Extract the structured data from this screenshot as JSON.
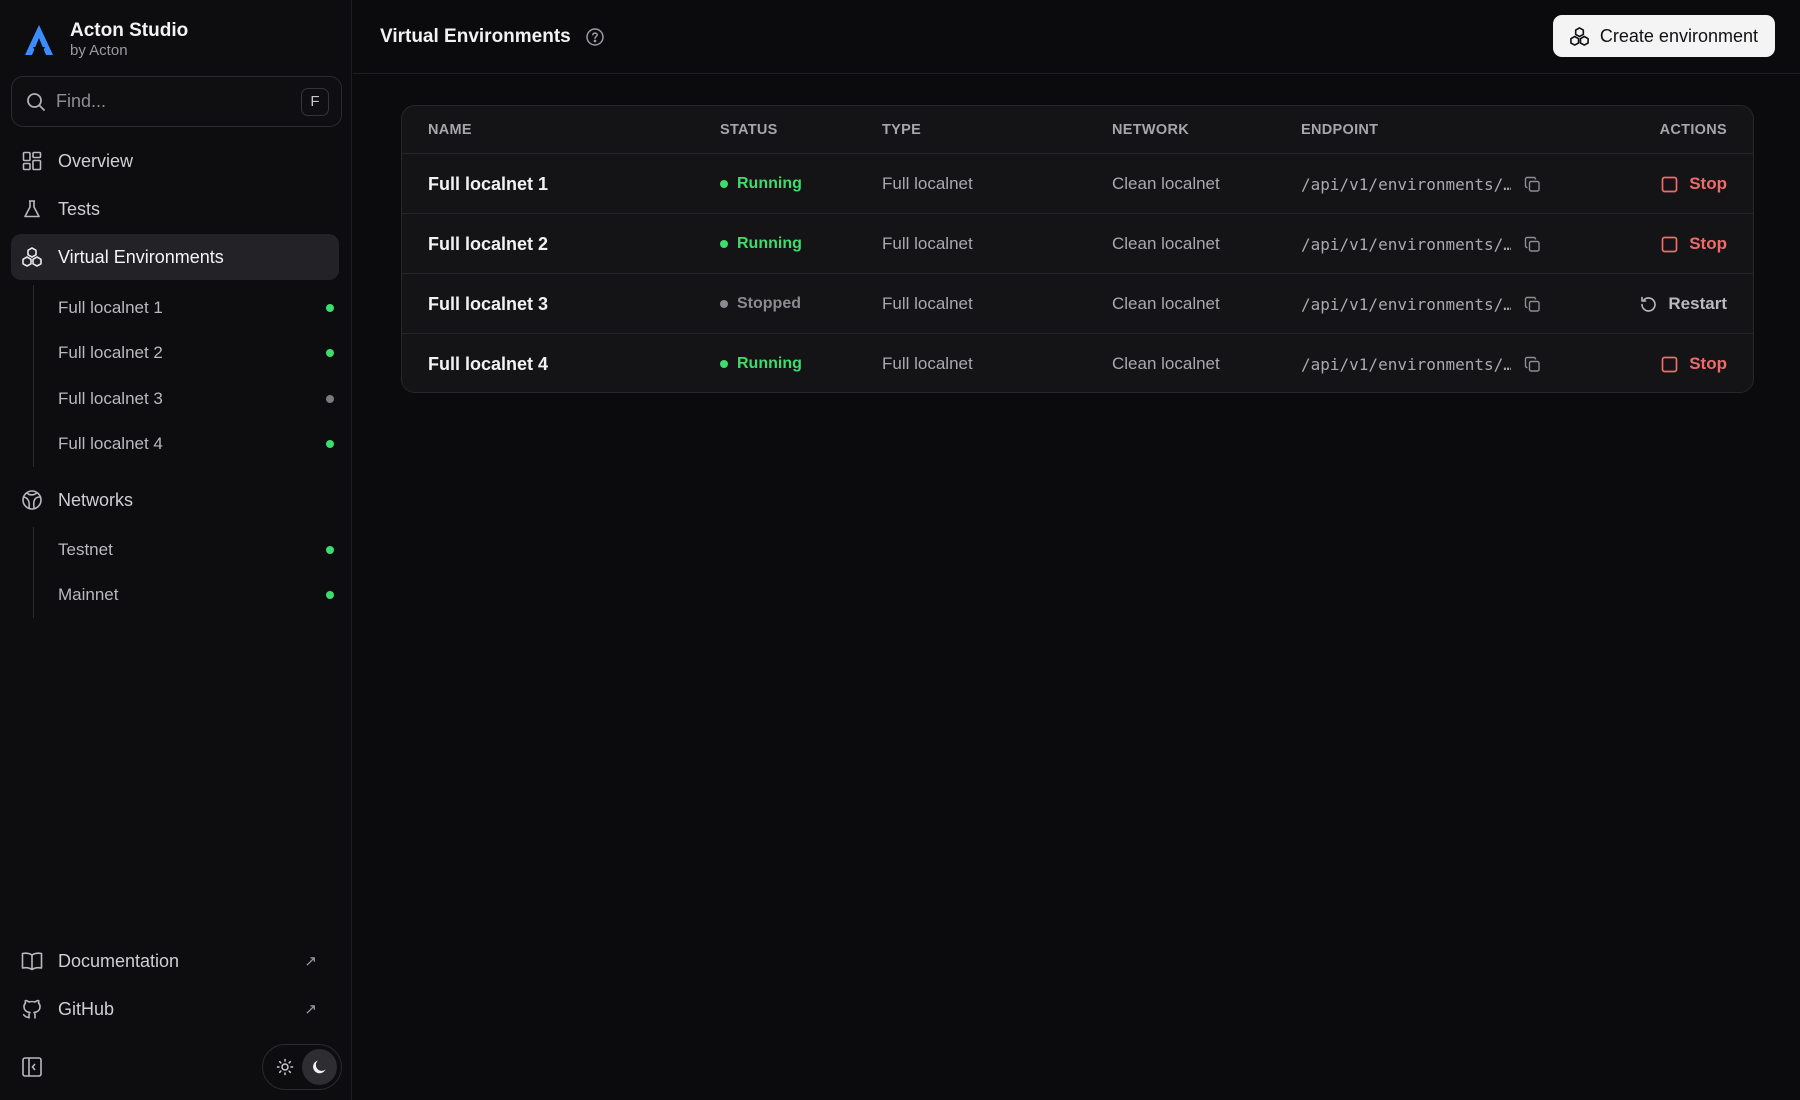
{
  "brand": {
    "title": "Acton Studio",
    "subtitle": "by Acton",
    "logo_icon": "acton-logo-icon",
    "accent": "#3a8cff"
  },
  "search": {
    "placeholder": "Find...",
    "shortcut": "F"
  },
  "nav": {
    "overview": "Overview",
    "tests": "Tests",
    "virtual_environments": "Virtual Environments",
    "networks": "Networks"
  },
  "environments": [
    {
      "label": "Full localnet 1",
      "status": "running"
    },
    {
      "label": "Full localnet 2",
      "status": "running"
    },
    {
      "label": "Full localnet 3",
      "status": "stopped"
    },
    {
      "label": "Full localnet 4",
      "status": "running"
    }
  ],
  "networks": [
    {
      "label": "Testnet",
      "status": "running"
    },
    {
      "label": "Mainnet",
      "status": "running"
    }
  ],
  "footer": {
    "documentation": "Documentation",
    "github": "GitHub",
    "external_icon": "↗"
  },
  "header": {
    "title": "Virtual Environments",
    "create_button": "Create environment"
  },
  "table": {
    "columns": [
      "NAME",
      "STATUS",
      "TYPE",
      "NETWORK",
      "ENDPOINT",
      "ACTIONS"
    ],
    "rows": [
      {
        "name": "Full localnet 1",
        "status": "Running",
        "type": "Full localnet",
        "network": "Clean localnet",
        "endpoint": "/api/v1/environments/…",
        "action": "Stop"
      },
      {
        "name": "Full localnet 2",
        "status": "Running",
        "type": "Full localnet",
        "network": "Clean localnet",
        "endpoint": "/api/v1/environments/…",
        "action": "Stop"
      },
      {
        "name": "Full localnet 3",
        "status": "Stopped",
        "type": "Full localnet",
        "network": "Clean localnet",
        "endpoint": "/api/v1/environments/…",
        "action": "Restart"
      },
      {
        "name": "Full localnet 4",
        "status": "Running",
        "type": "Full localnet",
        "network": "Clean localnet",
        "endpoint": "/api/v1/environments/…",
        "action": "Stop"
      }
    ]
  },
  "colors": {
    "running": "#3ddc6c",
    "stopped": "#8a8a90",
    "stop_action": "#f06a6a"
  }
}
